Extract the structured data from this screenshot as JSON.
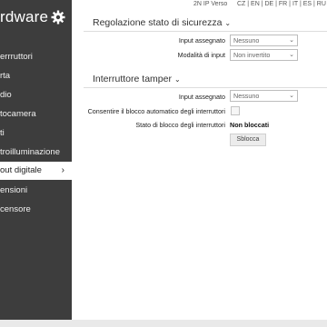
{
  "sidebar": {
    "title": "rdware",
    "items": [
      {
        "label": "errruttori"
      },
      {
        "label": "rta"
      },
      {
        "label": "dio"
      },
      {
        "label": "tocamera"
      },
      {
        "label": "ti"
      },
      {
        "label": "troilluminazione"
      },
      {
        "label": "out digitale",
        "chevron": "›"
      },
      {
        "label": "ensioni"
      },
      {
        "label": "censore"
      }
    ]
  },
  "topbar": {
    "product": "2N IP Verso",
    "languages": "CZ | EN | DE | FR | IT | ES | RU"
  },
  "safety_section": {
    "title": "Regolazione stato di sicurezza",
    "chevron": "⌄",
    "rows": [
      {
        "label": "Input assegnato",
        "value": "Nessuno"
      },
      {
        "label": "Modalità di input",
        "value": "Non invertito"
      }
    ]
  },
  "tamper_section": {
    "title": "Interruttore tamper",
    "chevron": "⌄",
    "input_label": "Input assegnato",
    "input_value": "Nessuno",
    "auto_lock_label": "Consentire il blocco automatico degli interruttori",
    "lock_status_label": "Stato di blocco degli interruttori",
    "lock_status_value": "Non bloccati",
    "unlock_button": "Sblocca"
  },
  "colors": {
    "sidebar_bg": "#3d3d3d",
    "active_item_bg": "#ffffff"
  }
}
